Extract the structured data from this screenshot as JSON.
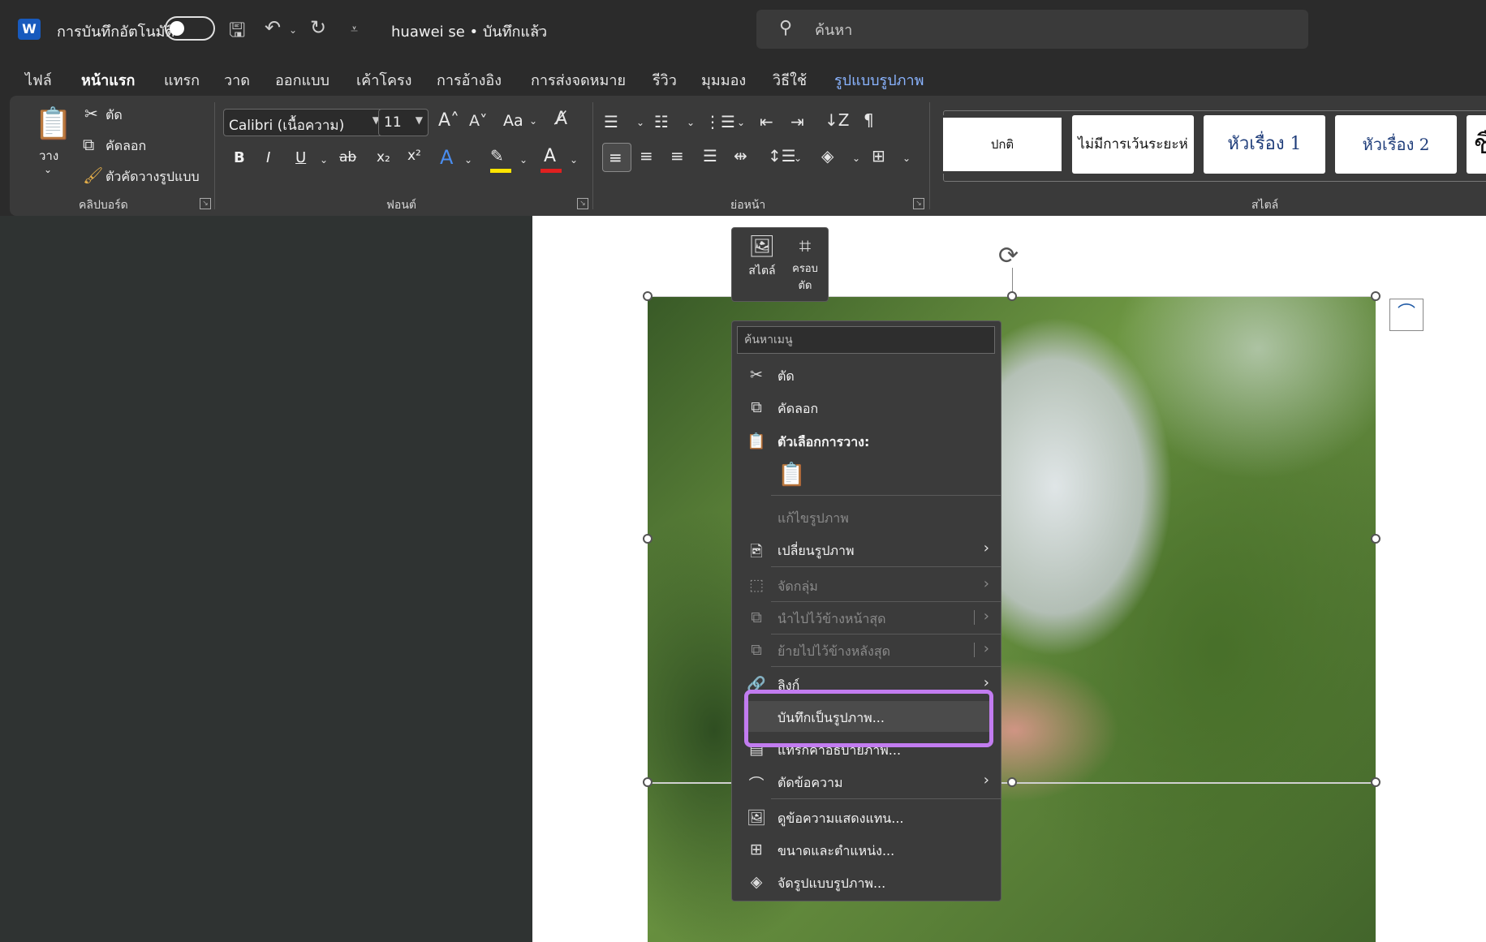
{
  "titlebar": {
    "app_logo": "W",
    "autosave_label": "การบันทึกอัตโนมัติ",
    "autosave_state": "off",
    "doc_title": "huawei se • บันทึกแล้ว",
    "search_placeholder": "ค้นหา"
  },
  "tabs": [
    {
      "label": "ไฟล์"
    },
    {
      "label": "หน้าแรก"
    },
    {
      "label": "แทรก"
    },
    {
      "label": "วาด"
    },
    {
      "label": "ออกแบบ"
    },
    {
      "label": "เค้าโครง"
    },
    {
      "label": "การอ้างอิง"
    },
    {
      "label": "การส่งจดหมาย"
    },
    {
      "label": "รีวิว"
    },
    {
      "label": "มุมมอง"
    },
    {
      "label": "วิธีใช้"
    },
    {
      "label": "รูปแบบรูปภาพ"
    }
  ],
  "ribbon": {
    "clipboard": {
      "paste": "วาง",
      "cut": "ตัด",
      "copy": "คัดลอก",
      "format_painter": "ตัวคัดวางรูปแบบ",
      "group": "คลิปบอร์ด"
    },
    "font": {
      "font_name": "Calibri (เนื้อความ)",
      "font_size": "11",
      "change_case": "Aa",
      "bold": "B",
      "italic": "I",
      "underline": "U",
      "strike": "ab",
      "subscript": "x₂",
      "superscript": "x²",
      "text_effects": "A",
      "font_color": "A",
      "group": "ฟอนต์"
    },
    "paragraph": {
      "group": "ย่อหน้า"
    },
    "styles": {
      "items": [
        "ปกติ",
        "ไม่มีการเว้นระยะห่",
        "หัวเรื่อง 1",
        "หัวเรื่อง 2",
        "ชื่"
      ],
      "group": "สไตล์"
    }
  },
  "mini_toolbar": {
    "style": "สไตล์",
    "crop_line1": "ครอบ",
    "crop_line2": "ตัด"
  },
  "context_menu": {
    "search_placeholder": "ค้นหาเมนู",
    "cut": "ตัด",
    "copy": "คัดลอก",
    "paste_options": "ตัวเลือกการวาง:",
    "edit_picture": "แก้ไขรูปภาพ",
    "change_picture": "เปลี่ยนรูปภาพ",
    "group": "จัดกลุ่ม",
    "bring_to_front": "นำไปไว้ข้างหน้าสุด",
    "send_to_back": "ย้ายไปไว้ข้างหลังสุด",
    "link": "ลิงก์",
    "save_as_picture": "บันทึกเป็นรูปภาพ...",
    "insert_caption": "แทรกคำอธิบายภาพ...",
    "wrap_text": "ตัดข้อความ",
    "view_alt_text": "ดูข้อความแสดงแทน...",
    "size_position": "ขนาดและตำแหน่ง...",
    "format_picture": "จัดรูปแบบรูปภาพ..."
  },
  "colors": {
    "highlight": "#c27cf0",
    "accent": "#6ea8ff"
  }
}
